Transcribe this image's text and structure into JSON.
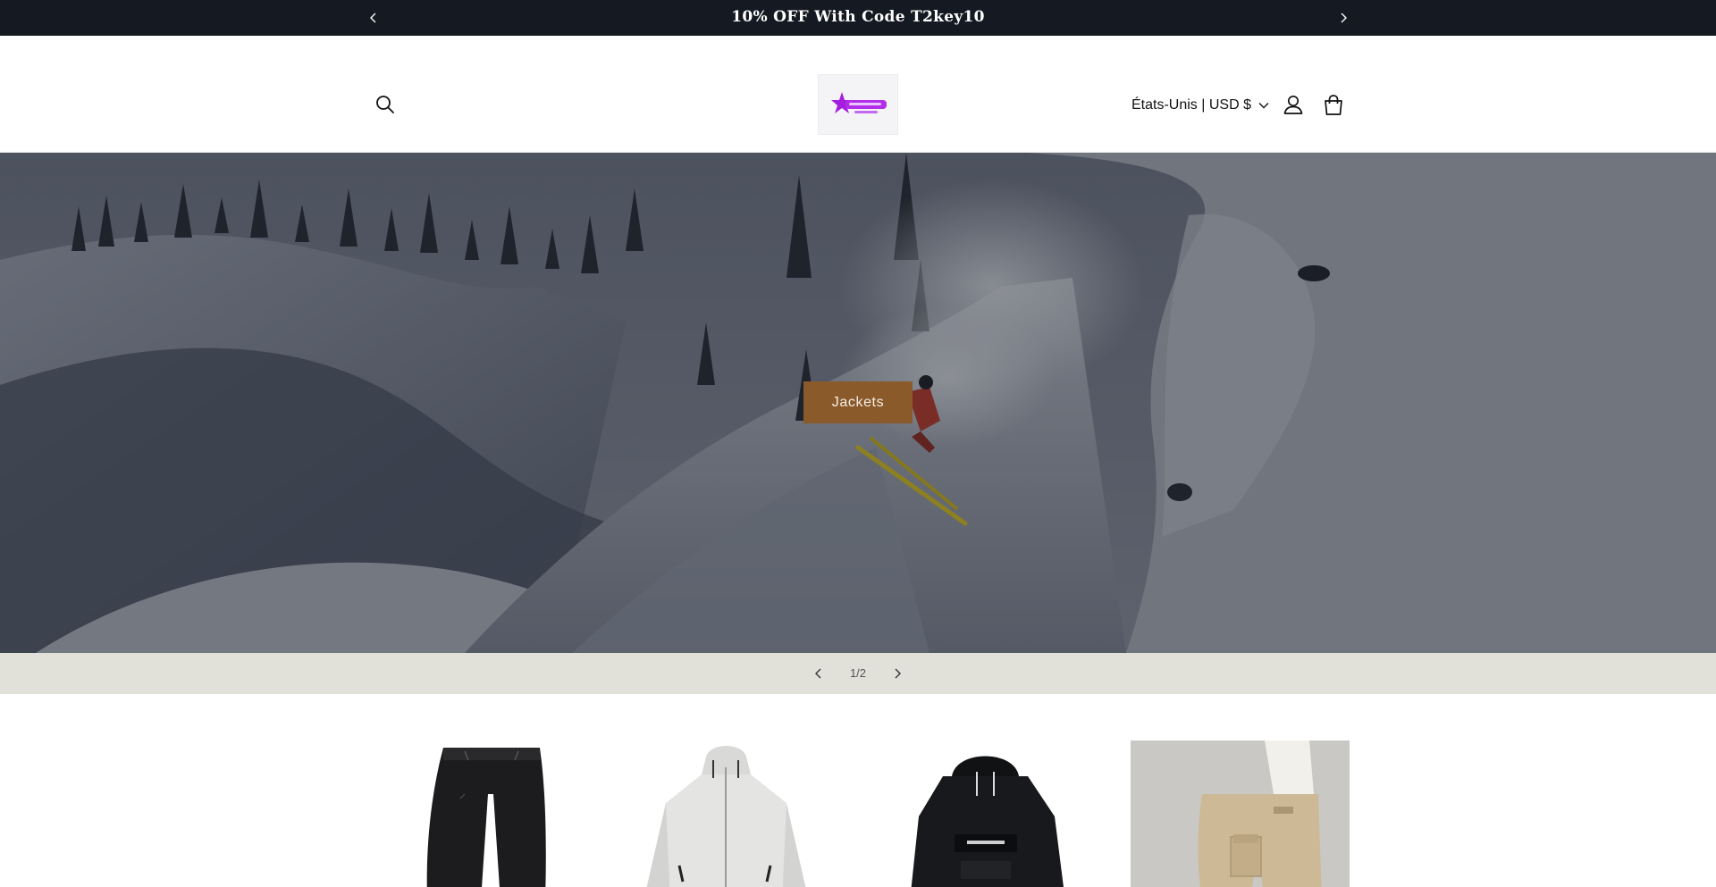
{
  "announcement": {
    "text": "10% OFF With Code T2key10",
    "prev_icon": "chevron-left-icon",
    "next_icon": "chevron-right-icon"
  },
  "header": {
    "search_icon": "search-icon",
    "logo_alt": "T2key logo",
    "country_selector": "États-Unis | USD $",
    "account_icon": "user-icon",
    "cart_icon": "cart-icon"
  },
  "hero": {
    "slide_button_label": "Jackets",
    "image_subject": "skier on a snowy mountain slope"
  },
  "slider": {
    "counter": "1/2",
    "prev_icon": "chevron-left-icon",
    "next_icon": "chevron-right-icon"
  },
  "products": [
    {
      "image": "black snow pants"
    },
    {
      "image": "light grey snow jacket"
    },
    {
      "image": "black anorak hoodie"
    },
    {
      "image": "beige cargo snow pants"
    }
  ],
  "colors": {
    "announcement_bg": "#141922",
    "cta_bg": "#8a5a2b",
    "slider_bar_bg": "#e1e1da",
    "logo_accent": "#a51ee0"
  }
}
